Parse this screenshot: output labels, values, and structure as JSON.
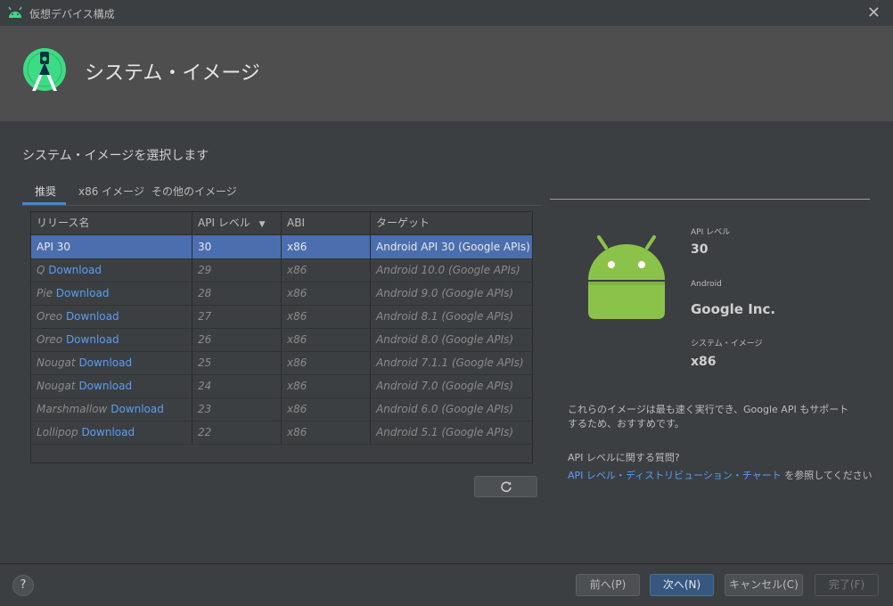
{
  "window": {
    "title": "仮想デバイス構成",
    "close_glyph": "✕"
  },
  "header": {
    "title": "システム・イメージ"
  },
  "section_title": "システム・イメージを選択します",
  "tabs": [
    {
      "label": "推奨",
      "active": true
    },
    {
      "label": "x86 イメージ",
      "active": false
    },
    {
      "label": "その他のイメージ",
      "active": false
    }
  ],
  "table": {
    "columns": [
      "リリース名",
      "API レベル",
      "ABI",
      "ターゲット"
    ],
    "sort_glyph": "▼",
    "rows": [
      {
        "name": "API 30",
        "download": "",
        "api": "30",
        "abi": "x86",
        "target": "Android API 30 (Google APIs)",
        "selected": true
      },
      {
        "name": "Q",
        "download": "Download",
        "api": "29",
        "abi": "x86",
        "target": "Android 10.0 (Google APIs)",
        "selected": false
      },
      {
        "name": "Pie",
        "download": "Download",
        "api": "28",
        "abi": "x86",
        "target": "Android 9.0 (Google APIs)",
        "selected": false
      },
      {
        "name": "Oreo",
        "download": "Download",
        "api": "27",
        "abi": "x86",
        "target": "Android 8.1 (Google APIs)",
        "selected": false
      },
      {
        "name": "Oreo",
        "download": "Download",
        "api": "26",
        "abi": "x86",
        "target": "Android 8.0 (Google APIs)",
        "selected": false
      },
      {
        "name": "Nougat",
        "download": "Download",
        "api": "25",
        "abi": "x86",
        "target": "Android 7.1.1 (Google APIs)",
        "selected": false
      },
      {
        "name": "Nougat",
        "download": "Download",
        "api": "24",
        "abi": "x86",
        "target": "Android 7.0 (Google APIs)",
        "selected": false
      },
      {
        "name": "Marshmallow",
        "download": "Download",
        "api": "23",
        "abi": "x86",
        "target": "Android 6.0 (Google APIs)",
        "selected": false
      },
      {
        "name": "Lollipop",
        "download": "Download",
        "api": "22",
        "abi": "x86",
        "target": "Android 5.1 (Google APIs)",
        "selected": false
      }
    ]
  },
  "refresh_icon": "refresh-icon",
  "details": {
    "api_label": "API レベル",
    "api_value": "30",
    "vendor_label": "Android",
    "vendor_value": "Google Inc.",
    "image_label": "システム・イメージ",
    "image_value": "x86",
    "description": "これらのイメージは最も速く実行でき、Google API もサポートするため、おすすめです。",
    "question": "API レベルに関する質問?",
    "link_text": "API レベル・ディストリビューション・チャート",
    "link_suffix": " を参照してください"
  },
  "footer": {
    "help": "?",
    "prev": "前へ(P)",
    "next": "次へ(N)",
    "cancel": "キャンセル(C)",
    "finish": "完了(F)"
  },
  "colors": {
    "accent": "#4b6eaf",
    "link": "#589df6",
    "android_green": "#8bc34a"
  }
}
